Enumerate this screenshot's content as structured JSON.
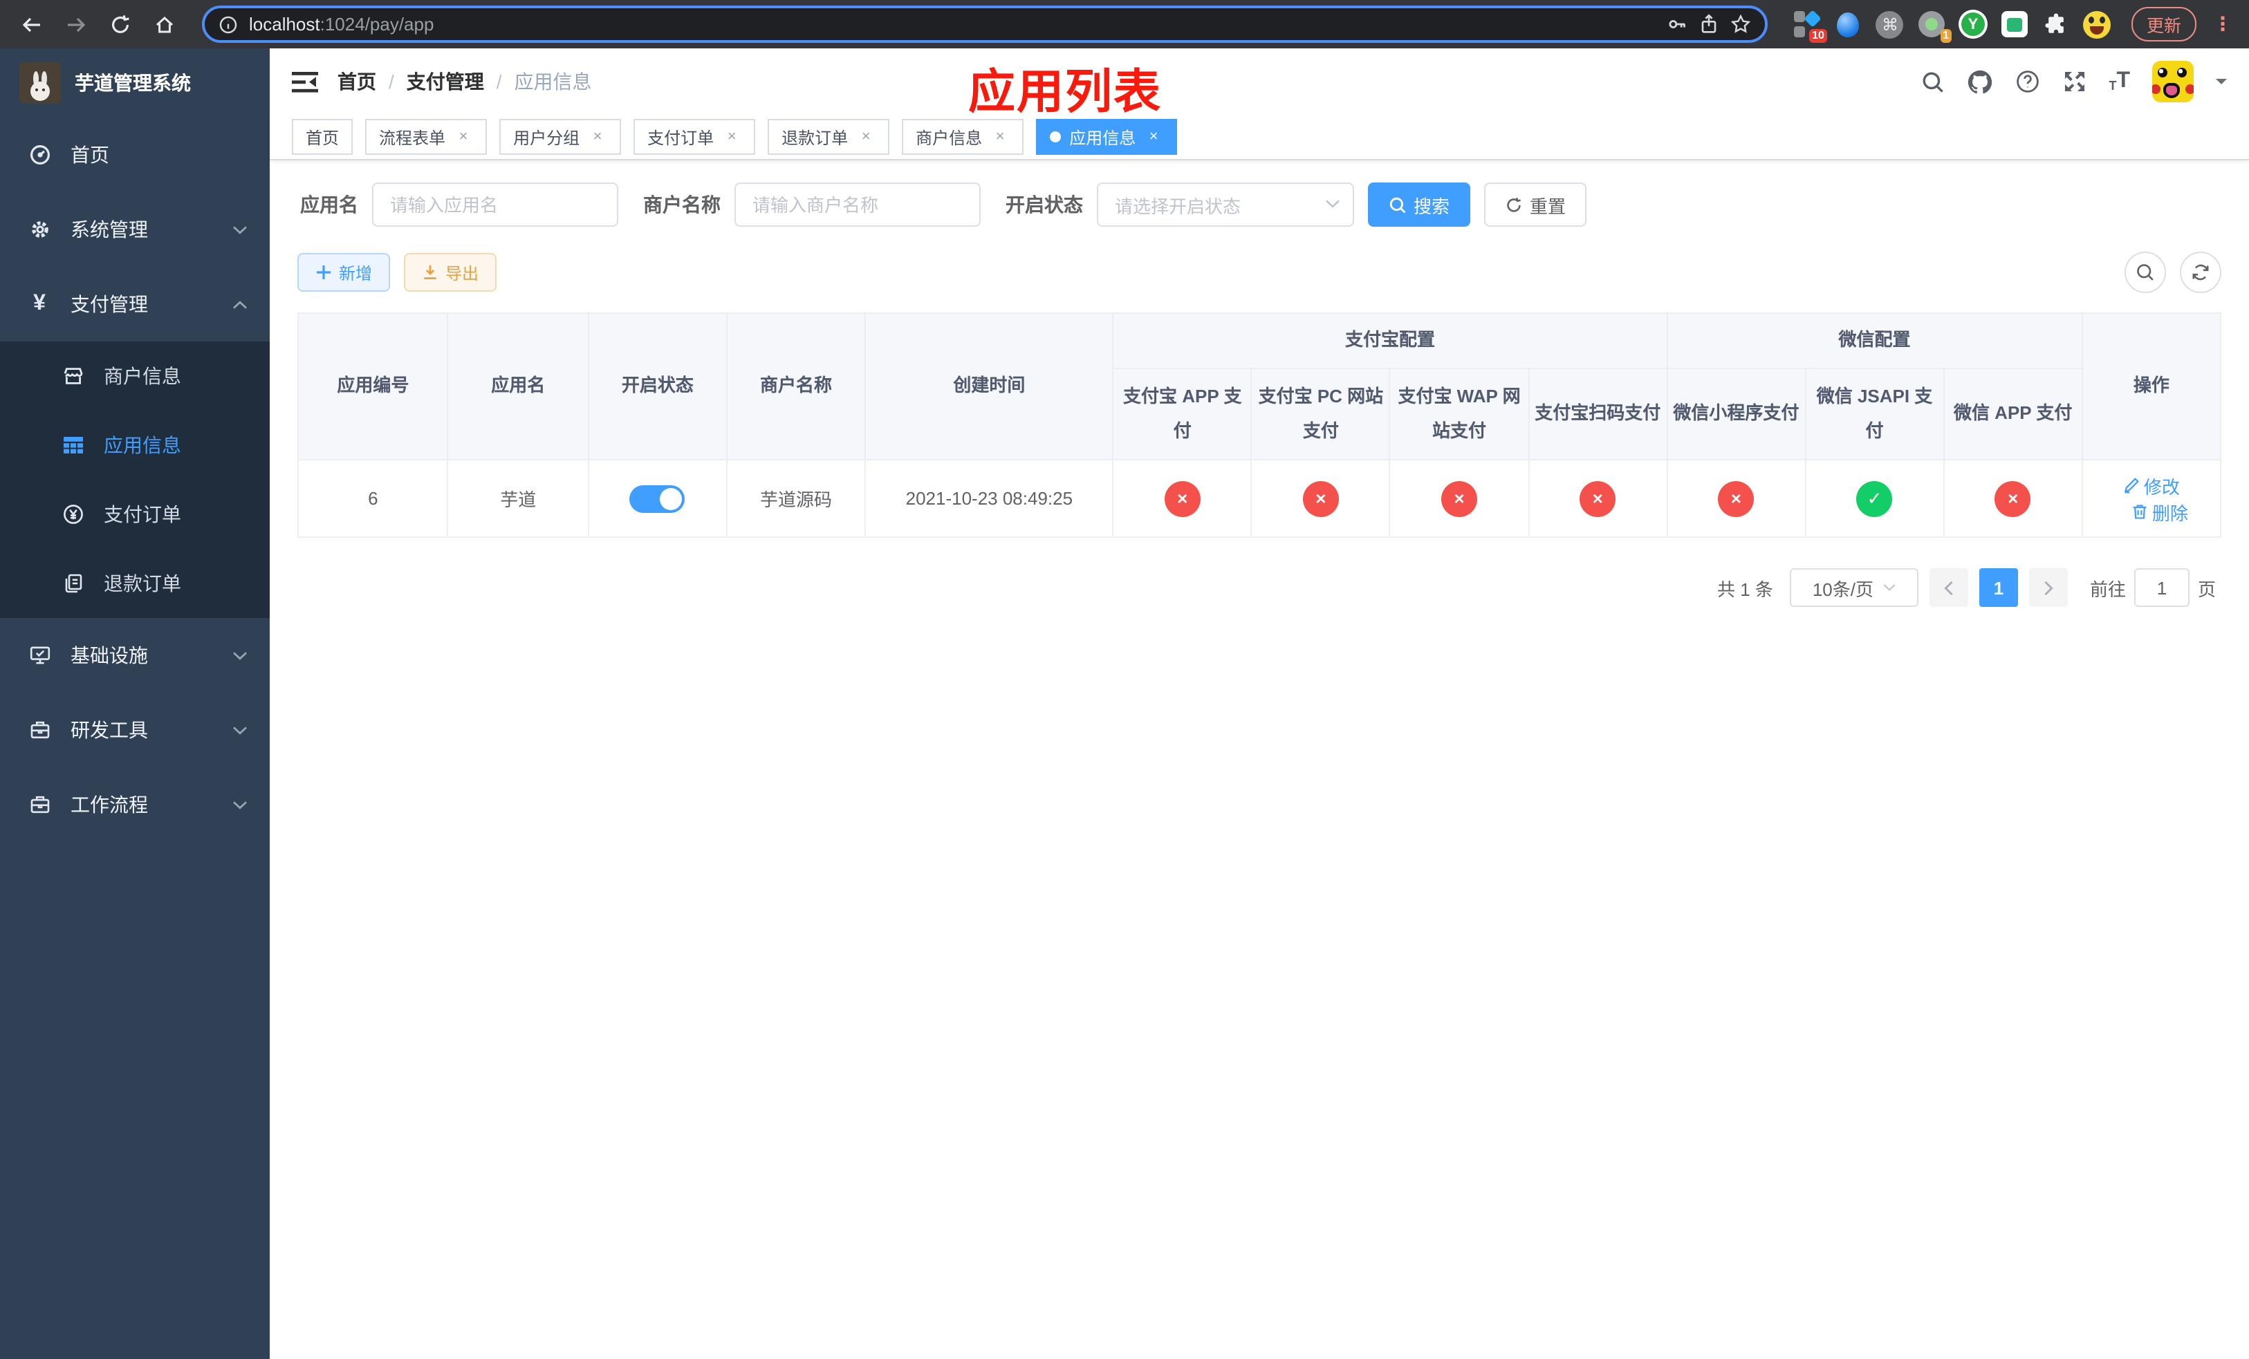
{
  "browser": {
    "url_host": "localhost",
    "url_rest": ":1024/pay/app",
    "update_label": "更新",
    "kebab": "⋮",
    "badges": {
      "sketch": "10",
      "tray": "1"
    },
    "ext_letter": "Y",
    "cmd_glyph": "⌘"
  },
  "sidebar": {
    "title": "芋道管理系统",
    "items": [
      {
        "label": "首页"
      },
      {
        "label": "系统管理"
      },
      {
        "label": "支付管理"
      },
      {
        "label": "商户信息"
      },
      {
        "label": "应用信息"
      },
      {
        "label": "支付订单"
      },
      {
        "label": "退款订单"
      },
      {
        "label": "基础设施"
      },
      {
        "label": "研发工具"
      },
      {
        "label": "工作流程"
      }
    ]
  },
  "navbar": {
    "breadcrumb": [
      "首页",
      "支付管理",
      "应用信息"
    ]
  },
  "annotation": "应用列表",
  "tabs": [
    {
      "label": "首页"
    },
    {
      "label": "流程表单"
    },
    {
      "label": "用户分组"
    },
    {
      "label": "支付订单"
    },
    {
      "label": "退款订单"
    },
    {
      "label": "商户信息"
    },
    {
      "label": "应用信息"
    }
  ],
  "search": {
    "app_name_label": "应用名",
    "app_name_placeholder": "请输入应用名",
    "merchant_label": "商户名称",
    "merchant_placeholder": "请输入商户名称",
    "status_label": "开启状态",
    "status_placeholder": "请选择开启状态",
    "search_label": "搜索",
    "reset_label": "重置"
  },
  "toolbar": {
    "add_label": "新增",
    "export_label": "导出"
  },
  "table": {
    "headers": {
      "id": "应用编号",
      "name": "应用名",
      "status": "开启状态",
      "merchant": "商户名称",
      "created": "创建时间",
      "ops": "操作"
    },
    "groups": {
      "alipay": "支付宝配置",
      "wechat": "微信配置"
    },
    "pay_columns": [
      "支付宝 APP 支付",
      "支付宝 PC 网站支付",
      "支付宝 WAP 网站支付",
      "支付宝扫码支付",
      "微信小程序支付",
      "微信 JSAPI 支付",
      "微信 APP 支付"
    ],
    "row": {
      "id": "6",
      "name": "芋道",
      "enabled": true,
      "merchant": "芋道源码",
      "created": "2021-10-23 08:49:25",
      "pay_status": [
        false,
        false,
        false,
        false,
        false,
        true,
        false
      ],
      "edit_label": "修改",
      "delete_label": "删除"
    }
  },
  "pagination": {
    "total": "共 1 条",
    "page_size": "10条/页",
    "current": "1",
    "goto_label": "前往",
    "goto_value": "1",
    "unit": "页"
  }
}
